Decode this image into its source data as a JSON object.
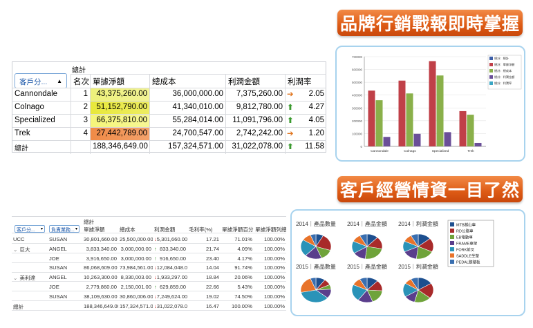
{
  "banners": {
    "top": "品牌行銷戰報即時掌握",
    "bottom": "客戶經營情資一目了然"
  },
  "pivot1": {
    "total_header": "總計",
    "filter_label": "客戶分...",
    "columns": [
      "名次",
      "單據淨額",
      "總成本",
      "利潤金額",
      "利潤率"
    ],
    "rows": [
      {
        "name": "Cannondale",
        "rank": "1",
        "net": "43,375,260.00",
        "cost": "36,000,000.00",
        "profit": "7,375,260.00",
        "arrow": "right",
        "rate": "2.05",
        "net_color": "#eef07a"
      },
      {
        "name": "Colnago",
        "rank": "2",
        "net": "51,152,790.00",
        "cost": "41,340,010.00",
        "profit": "9,812,780.00",
        "arrow": "up",
        "rate": "4.27",
        "net_color": "#e8e83a"
      },
      {
        "name": "Specialized",
        "rank": "3",
        "net": "66,375,810.00",
        "cost": "55,284,014.00",
        "profit": "11,091,796.00",
        "arrow": "up",
        "rate": "4.05",
        "net_color": "#f5f57a"
      },
      {
        "name": "Trek",
        "rank": "4",
        "net": "27,442,789.00",
        "cost": "24,700,547.00",
        "profit": "2,742,242.00",
        "arrow": "right",
        "rate": "1.20",
        "net_color": "#f08a46"
      }
    ],
    "total": {
      "name": "總計",
      "net": "188,346,649.00",
      "cost": "157,324,571.00",
      "profit": "31,022,078.00",
      "arrow": "up",
      "rate": "11.58"
    }
  },
  "chart_data": {
    "type": "bar",
    "categories": [
      "Cannondale",
      "Colnago",
      "Specialized",
      "Trek"
    ],
    "ylim": [
      0,
      700000
    ],
    "yticks": [
      "0",
      "100000",
      "200000",
      "300000",
      "400000",
      "500000",
      "600000",
      "700000"
    ],
    "series": [
      {
        "name": "總計：總計",
        "values": [
          0,
          0,
          0,
          0
        ],
        "color": "#3d5fa8"
      },
      {
        "name": "總計：單據淨額",
        "values": [
          435000,
          513000,
          665000,
          275000
        ],
        "color": "#c04048"
      },
      {
        "name": "總計：總成本",
        "values": [
          360000,
          413000,
          553000,
          247000
        ],
        "color": "#8ab04a"
      },
      {
        "name": "總計：利潤金額",
        "values": [
          74000,
          98000,
          111000,
          27000
        ],
        "color": "#6a4f98"
      },
      {
        "name": "總計：利潤率",
        "values": [
          0,
          0,
          0,
          0
        ],
        "color": "#3aa6c4"
      }
    ],
    "legend_position": "right"
  },
  "pivot2": {
    "total_header": "總計",
    "filter1": "客戶分...",
    "filter2": "負責業務...",
    "columns": [
      "單據淨額",
      "總成本",
      "利潤金額",
      "毛利率(%)",
      "單據淨額百分比",
      "單據淨額列總..."
    ],
    "rows": [
      {
        "group": "UCC",
        "expander": "",
        "rep": "SUSAN",
        "net": "30,801,660.00",
        "cost": "25,500,000.00",
        "arrow": "down",
        "profit": "5,301,660.00",
        "margin": "17.21",
        "pct": "71.01%",
        "row_pct": "100.00%"
      },
      {
        "group": "巨大",
        "expander": "⌄",
        "rep": "ANGEL",
        "net": "3,833,340.00",
        "cost": "3,000,000.00",
        "arrow": "up",
        "profit": "833,340.00",
        "margin": "21.74",
        "pct": "4.09%",
        "row_pct": "100.00%"
      },
      {
        "group": "",
        "expander": "",
        "rep": "JOE",
        "net": "3,916,650.00",
        "cost": "3,000,000.00",
        "arrow": "up",
        "profit": "916,650.00",
        "margin": "23.40",
        "pct": "4.17%",
        "row_pct": "100.00%"
      },
      {
        "group": "",
        "expander": "",
        "rep": "SUSAN",
        "net": "86,068,609.00",
        "cost": "73,984,561.00",
        "arrow": "down",
        "profit": "12,084,048.00",
        "margin": "14.04",
        "pct": "91.74%",
        "row_pct": "100.00%"
      },
      {
        "group": "美利達",
        "expander": "⌄",
        "rep": "ANGEL",
        "net": "10,263,300.00",
        "cost": "8,330,003.00",
        "arrow": "down",
        "profit": "1,933,297.00",
        "margin": "18.84",
        "pct": "20.06%",
        "row_pct": "100.00%"
      },
      {
        "group": "",
        "expander": "",
        "rep": "JOE",
        "net": "2,779,860.00",
        "cost": "2,150,001.00",
        "arrow": "up",
        "profit": "629,859.00",
        "margin": "22.66",
        "pct": "5.43%",
        "row_pct": "100.00%"
      },
      {
        "group": "",
        "expander": "",
        "rep": "SUSAN",
        "net": "38,109,630.00",
        "cost": "30,860,006.00",
        "arrow": "down",
        "profit": "7,249,624.00",
        "margin": "19.02",
        "pct": "74.50%",
        "row_pct": "100.00%"
      }
    ],
    "total": {
      "group": "總計",
      "net": "188,346,649.00",
      "cost": "157,324,571.00",
      "arrow": "down",
      "profit": "31,022,078.00",
      "margin": "16.47",
      "pct": "100.00%",
      "row_pct": "100.00%"
    }
  },
  "pies": {
    "titles": [
      "2014｜產品數量",
      "2014｜產品金額",
      "2014｜利潤金額",
      "2015｜產品數量",
      "2015｜產品金額",
      "2015｜利潤金額"
    ],
    "legend": [
      {
        "label": "MTB越山車",
        "color": "#1d4f8f"
      },
      {
        "label": "RD公路車",
        "color": "#a82a2a"
      },
      {
        "label": "EB電動車",
        "color": "#6fa33a"
      },
      {
        "label": "FRAME車架",
        "color": "#5a3e8c"
      },
      {
        "label": "FORK前叉",
        "color": "#2a93b8"
      },
      {
        "label": "SADDLE坐墊",
        "color": "#e8732a"
      },
      {
        "label": "PEDAL腳踏板",
        "color": "#3a6fb0"
      }
    ],
    "slices": [
      [
        0.08,
        0.22,
        0.14,
        0.18,
        0.22,
        0.1,
        0.06
      ],
      [
        0.12,
        0.16,
        0.24,
        0.14,
        0.16,
        0.1,
        0.08
      ],
      [
        0.14,
        0.18,
        0.2,
        0.16,
        0.14,
        0.1,
        0.08
      ],
      [
        0.1,
        0.08,
        0.06,
        0.12,
        0.36,
        0.22,
        0.06
      ],
      [
        0.12,
        0.14,
        0.18,
        0.16,
        0.22,
        0.1,
        0.08
      ],
      [
        0.16,
        0.2,
        0.18,
        0.12,
        0.18,
        0.08,
        0.08
      ]
    ]
  }
}
